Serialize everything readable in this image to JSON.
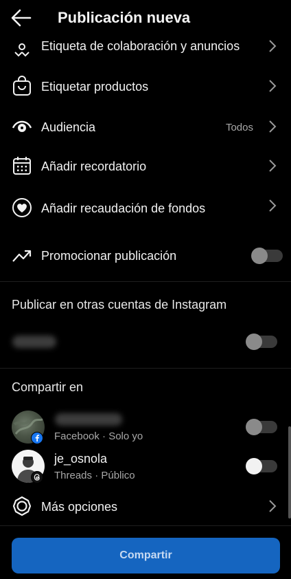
{
  "header": {
    "title": "Publicación nueva"
  },
  "options": [
    {
      "label": "Etiqueta de colaboración y anuncios",
      "icon": "collab-tag-icon"
    },
    {
      "label": "Etiquetar productos",
      "icon": "shopping-bag-icon"
    },
    {
      "label": "Audiencia",
      "icon": "audience-eye-icon",
      "value": "Todos"
    },
    {
      "label": "Añadir recordatorio",
      "icon": "calendar-icon"
    },
    {
      "label": "Añadir recaudación de fondos",
      "icon": "fundraiser-heart-icon"
    },
    {
      "label": "Promocionar publicación",
      "icon": "trending-up-icon",
      "toggle": false
    }
  ],
  "other_accounts": {
    "title": "Publicar en otras cuentas de Instagram",
    "toggle": false
  },
  "share_on": {
    "title": "Compartir en",
    "accounts": [
      {
        "platform": "Facebook",
        "privacy": "Solo yo",
        "sub": "Facebook · Solo yo",
        "toggle": false
      },
      {
        "name": "je_osnola",
        "platform": "Threads",
        "privacy": "Público",
        "sub": "Threads · Público",
        "toggle": false
      }
    ]
  },
  "more_options": {
    "label": "Más opciones",
    "icon": "gear-icon"
  },
  "share_button": {
    "label": "Compartir",
    "color": "#1565c0"
  }
}
